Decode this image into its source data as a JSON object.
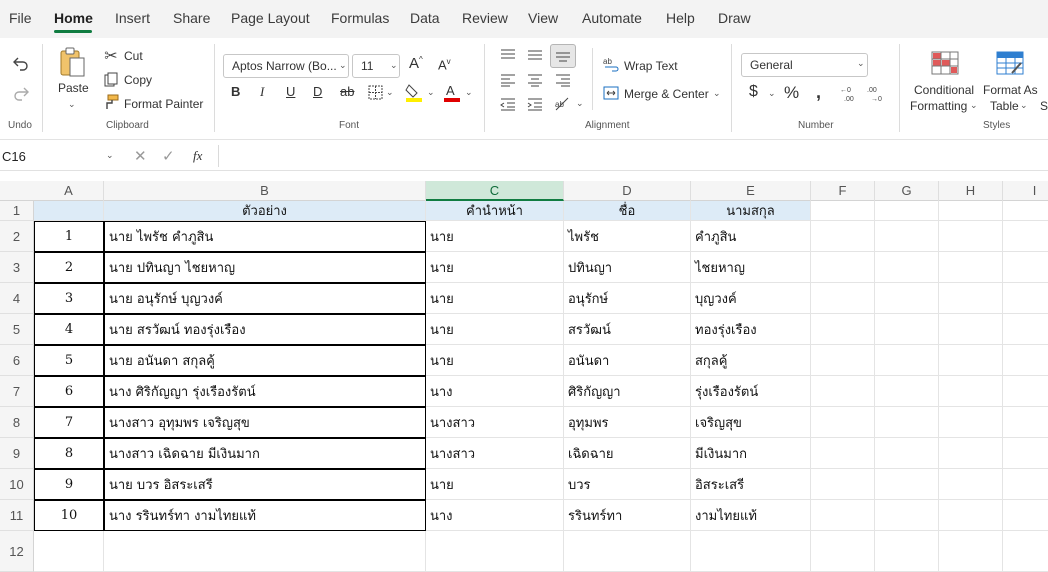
{
  "menu": [
    "File",
    "Home",
    "Insert",
    "Share",
    "Page Layout",
    "Formulas",
    "Data",
    "Review",
    "View",
    "Automate",
    "Help",
    "Draw"
  ],
  "ribbon": {
    "undo_label": "Undo",
    "clipboard": {
      "paste": "Paste",
      "cut": "Cut",
      "copy": "Copy",
      "format_painter": "Format Painter",
      "group": "Clipboard"
    },
    "font": {
      "name": "Aptos Narrow (Bo...",
      "size": "11",
      "group": "Font"
    },
    "alignment": {
      "wrap": "Wrap Text",
      "merge": "Merge & Center",
      "group": "Alignment"
    },
    "number": {
      "format": "General",
      "group": "Number"
    },
    "styles": {
      "conditional_1": "Conditional",
      "conditional_2": "Formatting",
      "format_as_1": "Format As",
      "format_as_2": "Table",
      "cell_styles_partial": "St",
      "group": "Styles"
    }
  },
  "formula_bar": {
    "name_box": "C16",
    "fx": "fx",
    "value": ""
  },
  "columns": [
    "A",
    "B",
    "C",
    "D",
    "E",
    "F",
    "G",
    "H",
    "I"
  ],
  "selected_column": "C",
  "rows": [
    "1",
    "2",
    "3",
    "4",
    "5",
    "6",
    "7",
    "8",
    "9",
    "10",
    "11",
    "12"
  ],
  "sheet": {
    "header": {
      "b": "ตัวอย่าง",
      "c": "คำนำหน้า",
      "d": "ชื่อ",
      "e": "นามสกุล"
    },
    "data": [
      {
        "a": "1",
        "b": "นาย ไพรัช คำภูสิน",
        "c": "นาย",
        "d": "ไพรัช",
        "e": "คำภูสิน"
      },
      {
        "a": "2",
        "b": "นาย ปทินญา ไชยหาญ",
        "c": "นาย",
        "d": "ปทินญา",
        "e": "ไชยหาญ"
      },
      {
        "a": "3",
        "b": "นาย อนุรักษ์ บุญวงค์",
        "c": "นาย",
        "d": "อนุรักษ์",
        "e": "บุญวงค์"
      },
      {
        "a": "4",
        "b": "นาย สรวัฒน์ ทองรุ่งเรือง",
        "c": "นาย",
        "d": "สรวัฒน์",
        "e": "ทองรุ่งเรือง"
      },
      {
        "a": "5",
        "b": "นาย อนันดา สกุลคู้",
        "c": "นาย",
        "d": "อนันดา",
        "e": "สกุลคู้"
      },
      {
        "a": "6",
        "b": "นาง ศิริกัญญา รุ่งเรืองรัตน์",
        "c": "นาง",
        "d": "ศิริกัญญา",
        "e": "รุ่งเรืองรัตน์"
      },
      {
        "a": "7",
        "b": "นางสาว อุทุมพร เจริญสุข",
        "c": "นางสาว",
        "d": "อุทุมพร",
        "e": "เจริญสุข"
      },
      {
        "a": "8",
        "b": "นางสาว เฉิดฉาย มีเงินมาก",
        "c": "นางสาว",
        "d": "เฉิดฉาย",
        "e": "มีเงินมาก"
      },
      {
        "a": "9",
        "b": "นาย บวร อิสระเสรี",
        "c": "นาย",
        "d": "บวร",
        "e": "อิสระเสรี"
      },
      {
        "a": "10",
        "b": "นาง รรินทร์ทา งามไทยแท้",
        "c": "นาง",
        "d": "รรินทร์ทา",
        "e": "งามไทยแท้"
      }
    ]
  },
  "colors": {
    "accent": "#107c41",
    "header_fill": "#ddebf7",
    "selected_col": "#cfe8d9"
  }
}
